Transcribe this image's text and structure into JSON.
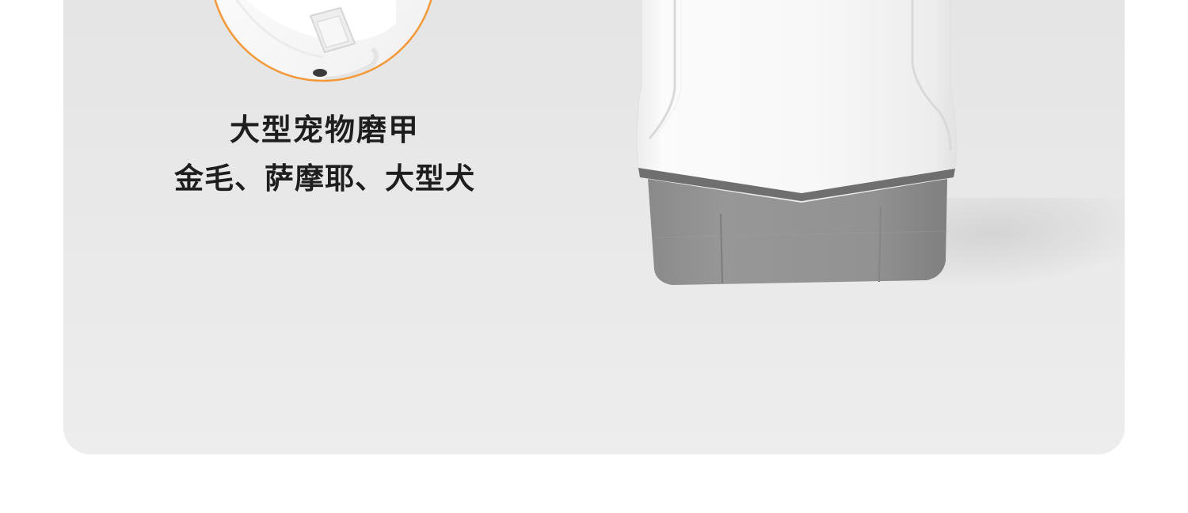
{
  "caption": {
    "title": "大型宠物磨甲",
    "subtitle": "金毛、萨摩耶、大型犬"
  },
  "colors": {
    "panel_background": "#e6e6e6",
    "page_background": "#ffffff",
    "inset_ring": "#f29a3a",
    "device_body": "#f7f7f7",
    "device_base": "#8e8e8e",
    "text": "#1e1e1e"
  },
  "icons": {
    "inset_image": "detail-lens-grinder-closeup",
    "product_image": "nail-grinder-device"
  }
}
